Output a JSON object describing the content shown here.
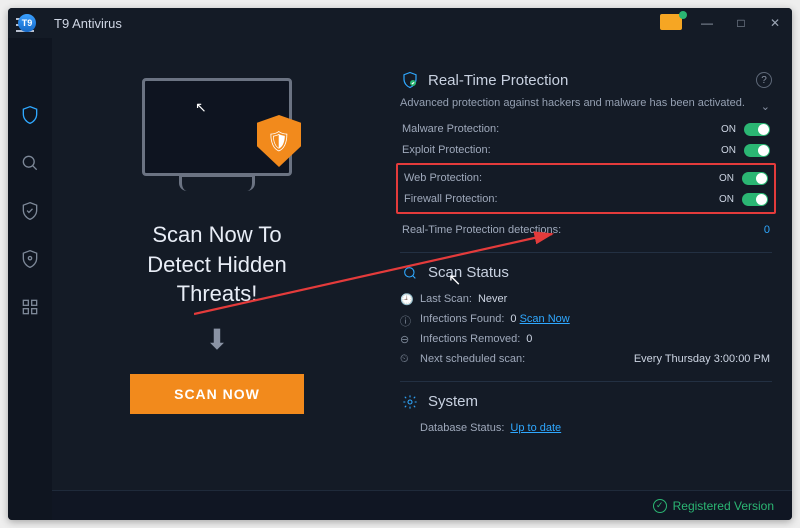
{
  "app": {
    "title": "T9 Antivirus",
    "logo_text": "T9"
  },
  "window_controls": {
    "min": "—",
    "max": "□",
    "close": "✕"
  },
  "sidebar": {
    "items": [
      {
        "name": "shield",
        "active": true
      },
      {
        "name": "search",
        "active": false
      },
      {
        "name": "quarantine",
        "active": false
      },
      {
        "name": "privacy",
        "active": false
      },
      {
        "name": "apps",
        "active": false
      }
    ]
  },
  "hero": {
    "headline_l1": "Scan Now To",
    "headline_l2": "Detect Hidden",
    "headline_l3": "Threats!",
    "scan_button": "SCAN NOW"
  },
  "rtp": {
    "title": "Real-Time Protection",
    "desc": "Advanced protection against hackers and malware has been activated.",
    "rows": [
      {
        "label": "Malware Protection:",
        "state": "ON"
      },
      {
        "label": "Exploit Protection:",
        "state": "ON"
      },
      {
        "label": "Web Protection:",
        "state": "ON",
        "highlight": true
      },
      {
        "label": "Firewall Protection:",
        "state": "ON",
        "highlight": true
      }
    ],
    "detections_label": "Real-Time Protection detections:",
    "detections_value": "0"
  },
  "scan_status": {
    "title": "Scan Status",
    "last_scan_label": "Last Scan:",
    "last_scan_value": "Never",
    "infections_found_label": "Infections Found:",
    "infections_found_value": "0",
    "scan_now_link": "Scan Now",
    "infections_removed_label": "Infections Removed:",
    "infections_removed_value": "0",
    "next_sched_label": "Next scheduled scan:",
    "next_sched_value": "Every Thursday 3:00:00 PM"
  },
  "system": {
    "title": "System",
    "db_label": "Database Status:",
    "db_value": "Up to date"
  },
  "footer": {
    "text": "Registered Version"
  }
}
